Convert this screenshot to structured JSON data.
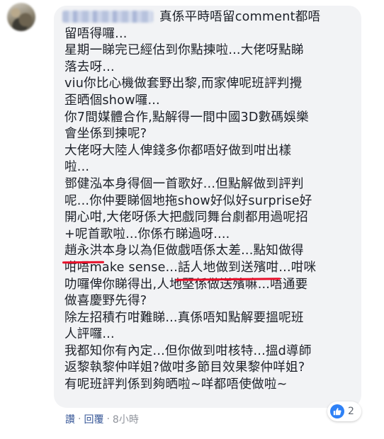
{
  "comment": {
    "text_lines": [
      "真係平時唔留comment都唔",
      "留唔得囉...",
      "星期一睇完已經估到你點揀啦...大佬呀點睇",
      "落去呀...",
      "viu你比心機做套野出黎,而家俾呢班評判攪",
      "歪晒個show囉...",
      "你7間媒體合作,點解得一間中國3D數碼娛樂",
      "會坐係到揀呢?",
      "大佬呀大陸人俾錢多你都唔好做到咁出樣",
      "啦...",
      "鄧健泓本身得個一首歌好...但點解做到評判",
      "呢...你仲要睇個地拖show好似好surprise好",
      "開心咁,大佬呀係大把戲同舞台劇都用過呢招",
      "+呢首歌啦...你係冇睇過呀....",
      "本身以為佢做戲唔係太差...點知做得",
      "咁唔make sense...",
      "...咁咪",
      "叻囉俾你睇得出,人地堅係做送殯嘛...唔通要",
      "做喜慶野先得?",
      "除左招積冇咁難睇...真係唔知點解要搵呢班",
      "人評囉...",
      "我都知你有內定...但你做到咁核特...搵d導師",
      "返黎執黎仲咩姐?做咁多節目效果黎仲咩姐?",
      "有呢班評判係到夠晒啦~咩都唔使做啦~"
    ],
    "highlight_1": "趙永洪",
    "highlight_2": "話人地做到送殯咁"
  },
  "reactions": {
    "icon": "thumbs-up-icon",
    "count": "2",
    "color": "#2e81f6"
  },
  "actions": {
    "like": "讚",
    "separator": "·",
    "reply": "回覆",
    "time": "8小時"
  },
  "colors": {
    "bubble": "#f2f3f5",
    "text": "#1d2129",
    "link": "#385898",
    "meta": "#90949c",
    "underline": "#e8102a"
  }
}
